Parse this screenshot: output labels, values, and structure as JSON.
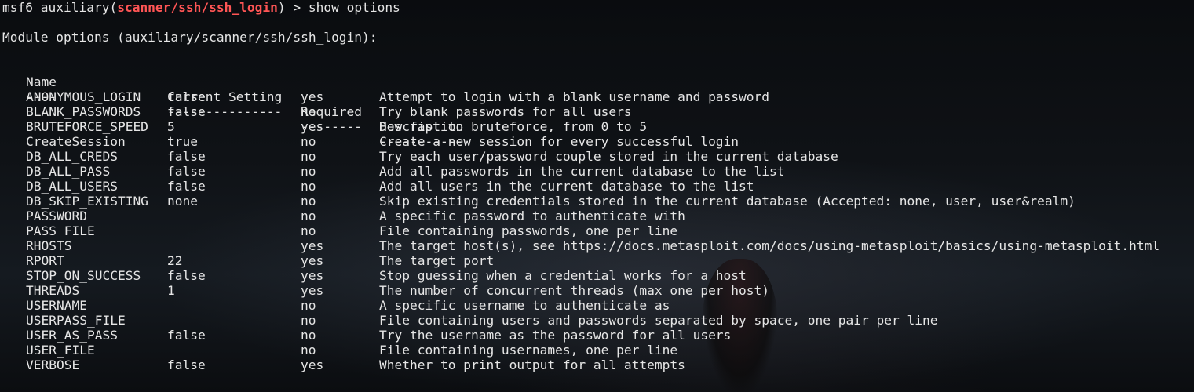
{
  "prompt": {
    "console": "msf6",
    "type": "auxiliary",
    "module": "scanner/ssh/ssh_login",
    "command": "show options"
  },
  "heading": "Module options (auxiliary/scanner/ssh/ssh_login):",
  "table": {
    "headers": [
      "Name",
      "Current Setting",
      "Required",
      "Description"
    ],
    "separators": [
      "----",
      "---------------",
      "--------",
      "-----------"
    ],
    "rows": [
      {
        "name": "ANONYMOUS_LOGIN",
        "setting": "false",
        "required": "yes",
        "description": "Attempt to login with a blank username and password"
      },
      {
        "name": "BLANK_PASSWORDS",
        "setting": "false",
        "required": "no",
        "description": "Try blank passwords for all users"
      },
      {
        "name": "BRUTEFORCE_SPEED",
        "setting": "5",
        "required": "yes",
        "description": "How fast to bruteforce, from 0 to 5"
      },
      {
        "name": "CreateSession",
        "setting": "true",
        "required": "no",
        "description": "Create a new session for every successful login"
      },
      {
        "name": "DB_ALL_CREDS",
        "setting": "false",
        "required": "no",
        "description": "Try each user/password couple stored in the current database"
      },
      {
        "name": "DB_ALL_PASS",
        "setting": "false",
        "required": "no",
        "description": "Add all passwords in the current database to the list"
      },
      {
        "name": "DB_ALL_USERS",
        "setting": "false",
        "required": "no",
        "description": "Add all users in the current database to the list"
      },
      {
        "name": "DB_SKIP_EXISTING",
        "setting": "none",
        "required": "no",
        "description": "Skip existing credentials stored in the current database (Accepted: none, user, user&realm)"
      },
      {
        "name": "PASSWORD",
        "setting": "",
        "required": "no",
        "description": "A specific password to authenticate with"
      },
      {
        "name": "PASS_FILE",
        "setting": "",
        "required": "no",
        "description": "File containing passwords, one per line"
      },
      {
        "name": "RHOSTS",
        "setting": "",
        "required": "yes",
        "description": "The target host(s), see https://docs.metasploit.com/docs/using-metasploit/basics/using-metasploit.html"
      },
      {
        "name": "RPORT",
        "setting": "22",
        "required": "yes",
        "description": "The target port"
      },
      {
        "name": "STOP_ON_SUCCESS",
        "setting": "false",
        "required": "yes",
        "description": "Stop guessing when a credential works for a host"
      },
      {
        "name": "THREADS",
        "setting": "1",
        "required": "yes",
        "description": "The number of concurrent threads (max one per host)"
      },
      {
        "name": "USERNAME",
        "setting": "",
        "required": "no",
        "description": "A specific username to authenticate as"
      },
      {
        "name": "USERPASS_FILE",
        "setting": "",
        "required": "no",
        "description": "File containing users and passwords separated by space, one pair per line"
      },
      {
        "name": "USER_AS_PASS",
        "setting": "false",
        "required": "no",
        "description": "Try the username as the password for all users"
      },
      {
        "name": "USER_FILE",
        "setting": "",
        "required": "no",
        "description": "File containing usernames, one per line"
      },
      {
        "name": "VERBOSE",
        "setting": "false",
        "required": "yes",
        "description": "Whether to print output for all attempts"
      }
    ]
  },
  "colors": {
    "background": "#0b0d10",
    "text": "#e6e6e6",
    "module_highlight": "#ff5555"
  }
}
